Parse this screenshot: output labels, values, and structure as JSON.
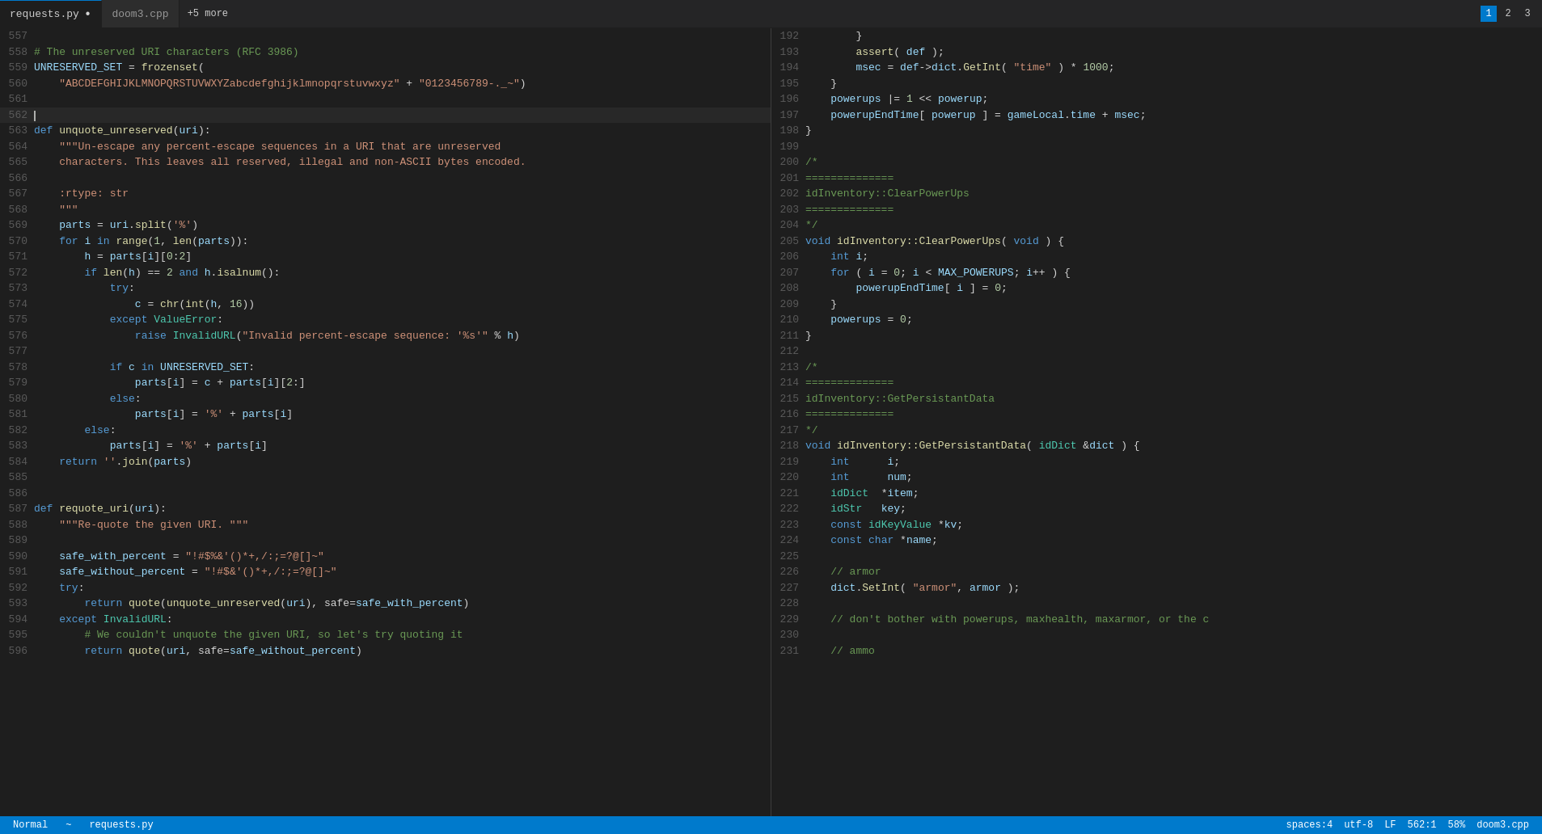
{
  "tabs": {
    "left_pane": [
      {
        "label": "requests.py",
        "modified": true,
        "active": true
      },
      {
        "label": "doom3.cpp",
        "modified": false,
        "active": false
      },
      {
        "label": "+5 more",
        "is_more": true
      }
    ]
  },
  "pane_indicators": [
    "1",
    "2",
    "3"
  ],
  "active_pane": "1",
  "status_bar": {
    "mode": "Normal",
    "tilde": "~",
    "filename_left": "requests.py",
    "spaces": "spaces:4",
    "encoding": "utf-8",
    "line_ending": "LF",
    "position": "562:1",
    "percent": "58%",
    "filename_right": "doom3.cpp"
  }
}
